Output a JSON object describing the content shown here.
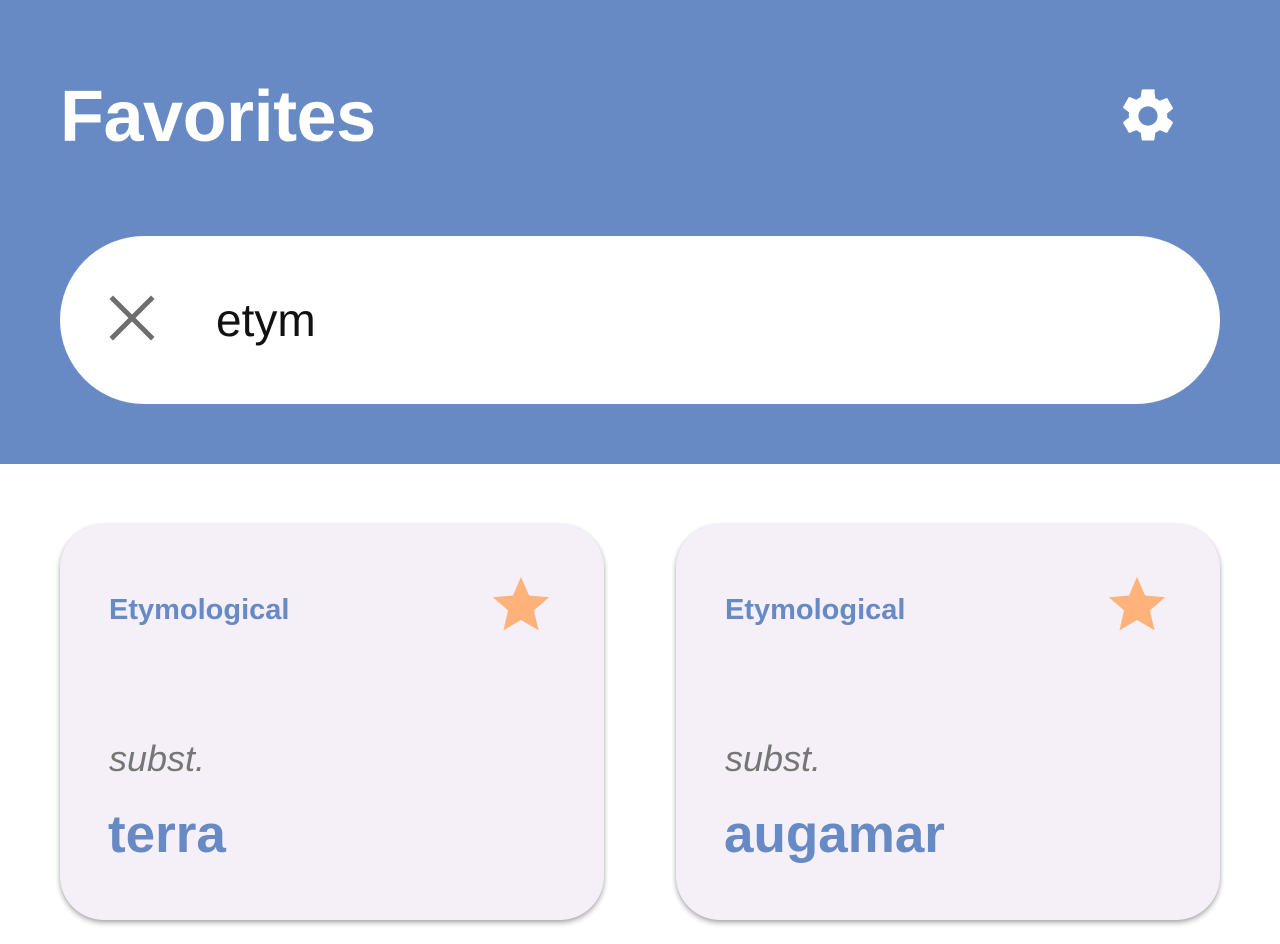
{
  "header": {
    "title": "Favorites",
    "settings_icon": "gear-icon",
    "background_color": "#6789c4"
  },
  "search": {
    "clear_icon": "close-icon",
    "value": "etym",
    "placeholder": ""
  },
  "cards": [
    {
      "category": "Etymological",
      "part_of_speech": "subst.",
      "word": "terra",
      "favorite_icon": "star-icon",
      "favorited": true
    },
    {
      "category": "Etymological",
      "part_of_speech": "subst.",
      "word": "augamar",
      "favorite_icon": "star-icon",
      "favorited": true
    }
  ],
  "colors": {
    "accent": "#6789c4",
    "star": "#ffb27a",
    "card_background": "#f5f0f8",
    "muted_text": "#767676"
  }
}
